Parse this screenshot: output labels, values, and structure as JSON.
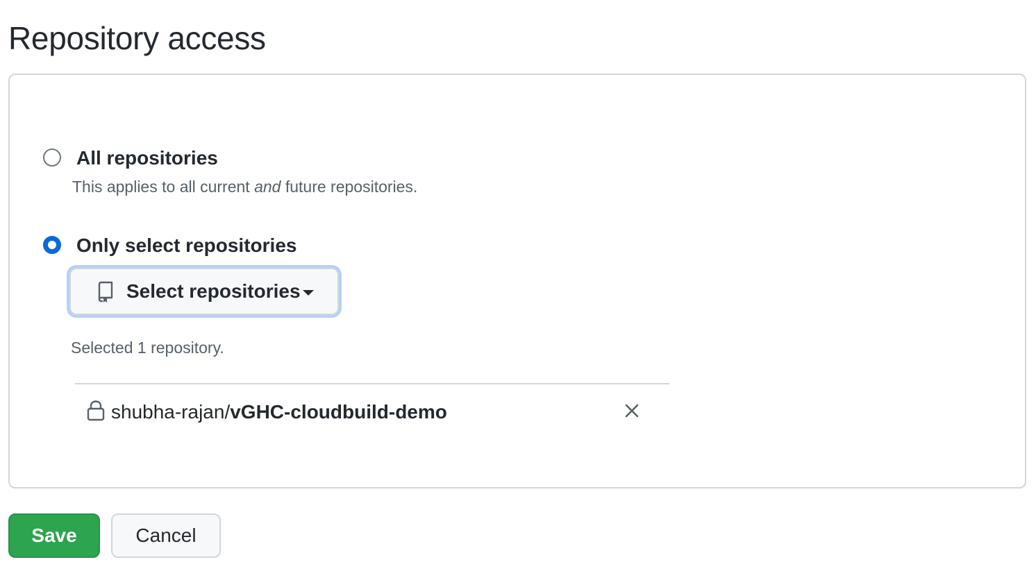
{
  "page": {
    "title": "Repository access"
  },
  "access": {
    "all": {
      "label": "All repositories",
      "note_start": "This applies to all current ",
      "note_emph": "and",
      "note_end": " future repositories.",
      "selected": false
    },
    "select": {
      "label": "Only select repositories",
      "selected": true,
      "button_label": "Select repositories",
      "button_icon": "repo-icon",
      "selected_count_text": "Selected 1 repository."
    }
  },
  "repositories": [
    {
      "owner": "shubha-rajan/",
      "name": "vGHC-cloudbuild-demo",
      "icon": "lock-icon",
      "remove_icon": "close-icon"
    }
  ],
  "actions": {
    "save_label": "Save",
    "cancel_label": "Cancel"
  },
  "colors": {
    "primary_button": "#2da44e",
    "accent": "#0969da",
    "border": "#d0d7de"
  }
}
